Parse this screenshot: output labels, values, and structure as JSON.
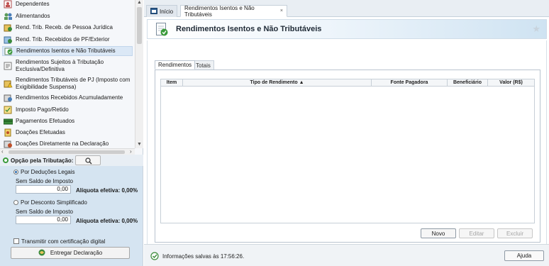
{
  "nav": {
    "items": [
      {
        "label": "Dependentes",
        "icon": "dependents-icon"
      },
      {
        "label": "Alimentandos",
        "icon": "people-icon"
      },
      {
        "label": "Rend. Trib. Receb. de Pessoa Jurídica",
        "icon": "income-pj-icon"
      },
      {
        "label": "Rend. Trib. Recebidos de PF/Exterior",
        "icon": "income-pf-icon"
      },
      {
        "label": "Rendimentos Isentos e Não Tributáveis",
        "icon": "exempt-income-icon",
        "selected": true
      },
      {
        "label": "Rendimentos Sujeitos à Tributação Exclusiva/Definitiva",
        "icon": "exclusive-tax-icon"
      },
      {
        "label": "Rendimentos Tributáveis de PJ (Imposto com Exigibilidade Suspensa)",
        "icon": "suspended-tax-icon"
      },
      {
        "label": "Rendimentos Recebidos Acumuladamente",
        "icon": "accumulated-income-icon"
      },
      {
        "label": "Imposto Pago/Retido",
        "icon": "tax-paid-icon"
      },
      {
        "label": "Pagamentos Efetuados",
        "icon": "payments-icon"
      },
      {
        "label": "Doações Efetuadas",
        "icon": "donations-icon"
      },
      {
        "label": "Doações Diretamente na Declaração",
        "icon": "direct-donations-icon"
      }
    ]
  },
  "tax_option": {
    "title": "Opção pela Tributação:",
    "legal_deductions": {
      "label": "Por Deduções Legais",
      "selected": true,
      "balance_label": "Sem Saldo de Imposto",
      "value": "0,00",
      "rate_label": "Alíquota efetiva: 0,00%"
    },
    "simplified": {
      "label": "Por Desconto Simplificado",
      "selected": false,
      "balance_label": "Sem Saldo de Imposto",
      "value": "0,00",
      "rate_label": "Alíquota efetiva: 0,00%"
    },
    "certificate_label": "Transmitir com certificação digital",
    "certificate_checked": false,
    "submit_label": "Entregar Declaração"
  },
  "tabs": {
    "home_label": "Início",
    "current_label": "Rendimentos Isentos e Não Tributáveis",
    "close_symbol": "×"
  },
  "banner": {
    "title": "Rendimentos Isentos e Não Tributáveis",
    "star": "★"
  },
  "subtabs": [
    "Rendimentos",
    "Totais"
  ],
  "grid": {
    "columns": [
      "Item",
      "Tipo de Rendimento ▲",
      "Fonte Pagadora",
      "Beneficiário",
      "Valor (R$)"
    ],
    "rows": []
  },
  "buttons": {
    "new": "Novo",
    "edit": "Editar",
    "delete": "Excluir",
    "help": "Ajuda"
  },
  "status": {
    "text": "Informações salvas às 17:56:26."
  },
  "colors": {
    "panel_bg": "#d5e4f1",
    "selected_bg": "#dbe8f6",
    "banner_accent": "#cfe3f2",
    "check_green": "#3a9a3a"
  }
}
